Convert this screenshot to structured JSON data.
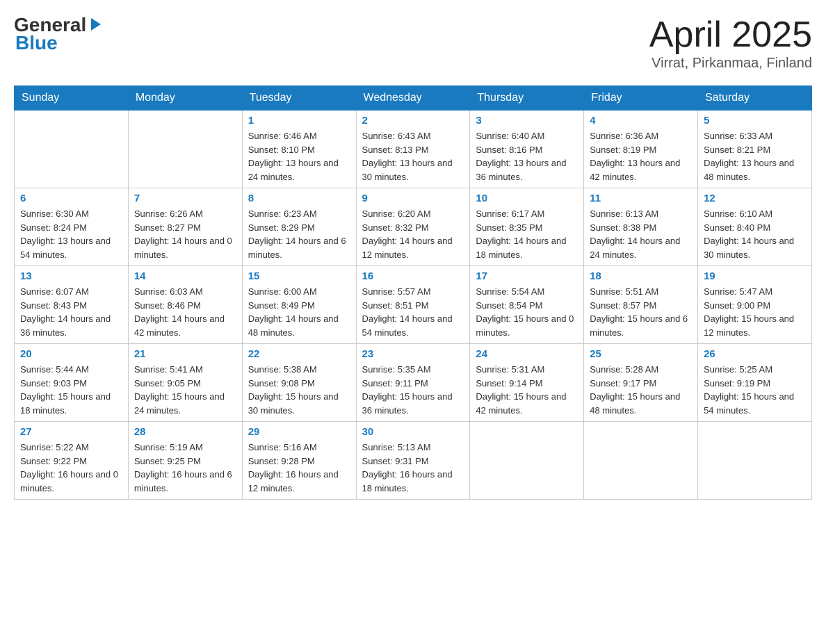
{
  "header": {
    "logo": {
      "general": "General",
      "blue": "Blue"
    },
    "title": "April 2025",
    "subtitle": "Virrat, Pirkanmaa, Finland"
  },
  "calendar": {
    "days": [
      "Sunday",
      "Monday",
      "Tuesday",
      "Wednesday",
      "Thursday",
      "Friday",
      "Saturday"
    ],
    "weeks": [
      [
        {
          "day": "",
          "sunrise": "",
          "sunset": "",
          "daylight": ""
        },
        {
          "day": "",
          "sunrise": "",
          "sunset": "",
          "daylight": ""
        },
        {
          "day": "1",
          "sunrise": "Sunrise: 6:46 AM",
          "sunset": "Sunset: 8:10 PM",
          "daylight": "Daylight: 13 hours and 24 minutes."
        },
        {
          "day": "2",
          "sunrise": "Sunrise: 6:43 AM",
          "sunset": "Sunset: 8:13 PM",
          "daylight": "Daylight: 13 hours and 30 minutes."
        },
        {
          "day": "3",
          "sunrise": "Sunrise: 6:40 AM",
          "sunset": "Sunset: 8:16 PM",
          "daylight": "Daylight: 13 hours and 36 minutes."
        },
        {
          "day": "4",
          "sunrise": "Sunrise: 6:36 AM",
          "sunset": "Sunset: 8:19 PM",
          "daylight": "Daylight: 13 hours and 42 minutes."
        },
        {
          "day": "5",
          "sunrise": "Sunrise: 6:33 AM",
          "sunset": "Sunset: 8:21 PM",
          "daylight": "Daylight: 13 hours and 48 minutes."
        }
      ],
      [
        {
          "day": "6",
          "sunrise": "Sunrise: 6:30 AM",
          "sunset": "Sunset: 8:24 PM",
          "daylight": "Daylight: 13 hours and 54 minutes."
        },
        {
          "day": "7",
          "sunrise": "Sunrise: 6:26 AM",
          "sunset": "Sunset: 8:27 PM",
          "daylight": "Daylight: 14 hours and 0 minutes."
        },
        {
          "day": "8",
          "sunrise": "Sunrise: 6:23 AM",
          "sunset": "Sunset: 8:29 PM",
          "daylight": "Daylight: 14 hours and 6 minutes."
        },
        {
          "day": "9",
          "sunrise": "Sunrise: 6:20 AM",
          "sunset": "Sunset: 8:32 PM",
          "daylight": "Daylight: 14 hours and 12 minutes."
        },
        {
          "day": "10",
          "sunrise": "Sunrise: 6:17 AM",
          "sunset": "Sunset: 8:35 PM",
          "daylight": "Daylight: 14 hours and 18 minutes."
        },
        {
          "day": "11",
          "sunrise": "Sunrise: 6:13 AM",
          "sunset": "Sunset: 8:38 PM",
          "daylight": "Daylight: 14 hours and 24 minutes."
        },
        {
          "day": "12",
          "sunrise": "Sunrise: 6:10 AM",
          "sunset": "Sunset: 8:40 PM",
          "daylight": "Daylight: 14 hours and 30 minutes."
        }
      ],
      [
        {
          "day": "13",
          "sunrise": "Sunrise: 6:07 AM",
          "sunset": "Sunset: 8:43 PM",
          "daylight": "Daylight: 14 hours and 36 minutes."
        },
        {
          "day": "14",
          "sunrise": "Sunrise: 6:03 AM",
          "sunset": "Sunset: 8:46 PM",
          "daylight": "Daylight: 14 hours and 42 minutes."
        },
        {
          "day": "15",
          "sunrise": "Sunrise: 6:00 AM",
          "sunset": "Sunset: 8:49 PM",
          "daylight": "Daylight: 14 hours and 48 minutes."
        },
        {
          "day": "16",
          "sunrise": "Sunrise: 5:57 AM",
          "sunset": "Sunset: 8:51 PM",
          "daylight": "Daylight: 14 hours and 54 minutes."
        },
        {
          "day": "17",
          "sunrise": "Sunrise: 5:54 AM",
          "sunset": "Sunset: 8:54 PM",
          "daylight": "Daylight: 15 hours and 0 minutes."
        },
        {
          "day": "18",
          "sunrise": "Sunrise: 5:51 AM",
          "sunset": "Sunset: 8:57 PM",
          "daylight": "Daylight: 15 hours and 6 minutes."
        },
        {
          "day": "19",
          "sunrise": "Sunrise: 5:47 AM",
          "sunset": "Sunset: 9:00 PM",
          "daylight": "Daylight: 15 hours and 12 minutes."
        }
      ],
      [
        {
          "day": "20",
          "sunrise": "Sunrise: 5:44 AM",
          "sunset": "Sunset: 9:03 PM",
          "daylight": "Daylight: 15 hours and 18 minutes."
        },
        {
          "day": "21",
          "sunrise": "Sunrise: 5:41 AM",
          "sunset": "Sunset: 9:05 PM",
          "daylight": "Daylight: 15 hours and 24 minutes."
        },
        {
          "day": "22",
          "sunrise": "Sunrise: 5:38 AM",
          "sunset": "Sunset: 9:08 PM",
          "daylight": "Daylight: 15 hours and 30 minutes."
        },
        {
          "day": "23",
          "sunrise": "Sunrise: 5:35 AM",
          "sunset": "Sunset: 9:11 PM",
          "daylight": "Daylight: 15 hours and 36 minutes."
        },
        {
          "day": "24",
          "sunrise": "Sunrise: 5:31 AM",
          "sunset": "Sunset: 9:14 PM",
          "daylight": "Daylight: 15 hours and 42 minutes."
        },
        {
          "day": "25",
          "sunrise": "Sunrise: 5:28 AM",
          "sunset": "Sunset: 9:17 PM",
          "daylight": "Daylight: 15 hours and 48 minutes."
        },
        {
          "day": "26",
          "sunrise": "Sunrise: 5:25 AM",
          "sunset": "Sunset: 9:19 PM",
          "daylight": "Daylight: 15 hours and 54 minutes."
        }
      ],
      [
        {
          "day": "27",
          "sunrise": "Sunrise: 5:22 AM",
          "sunset": "Sunset: 9:22 PM",
          "daylight": "Daylight: 16 hours and 0 minutes."
        },
        {
          "day": "28",
          "sunrise": "Sunrise: 5:19 AM",
          "sunset": "Sunset: 9:25 PM",
          "daylight": "Daylight: 16 hours and 6 minutes."
        },
        {
          "day": "29",
          "sunrise": "Sunrise: 5:16 AM",
          "sunset": "Sunset: 9:28 PM",
          "daylight": "Daylight: 16 hours and 12 minutes."
        },
        {
          "day": "30",
          "sunrise": "Sunrise: 5:13 AM",
          "sunset": "Sunset: 9:31 PM",
          "daylight": "Daylight: 16 hours and 18 minutes."
        },
        {
          "day": "",
          "sunrise": "",
          "sunset": "",
          "daylight": ""
        },
        {
          "day": "",
          "sunrise": "",
          "sunset": "",
          "daylight": ""
        },
        {
          "day": "",
          "sunrise": "",
          "sunset": "",
          "daylight": ""
        }
      ]
    ]
  }
}
